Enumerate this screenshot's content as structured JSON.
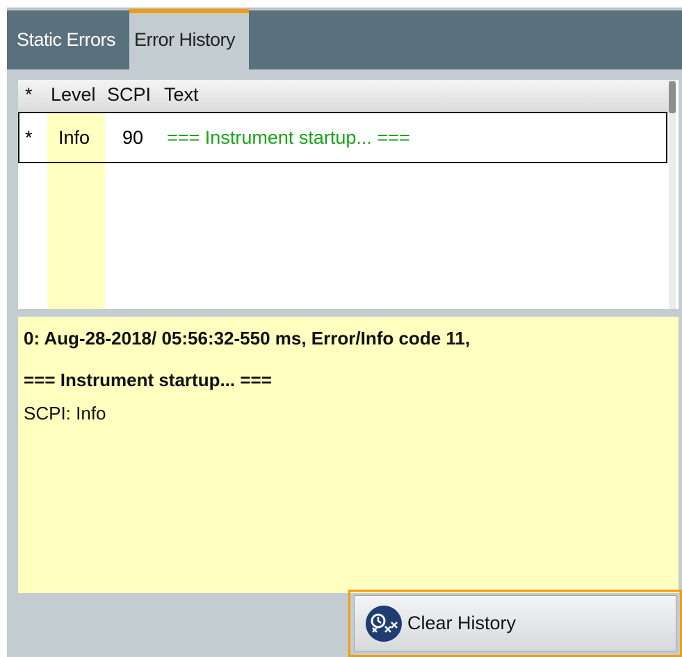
{
  "tabs": [
    {
      "label": "Static Errors"
    },
    {
      "label": "Error History"
    }
  ],
  "table": {
    "columns": [
      "*",
      "Level",
      "SCPI",
      "Text"
    ],
    "rows": [
      {
        "marker": "*",
        "level": "Info",
        "scpi": "90",
        "text": "=== Instrument startup... ==="
      }
    ]
  },
  "details": {
    "line1": "0: Aug-28-2018/ 05:56:32-550 ms, Error/Info code 11,",
    "line2": "=== Instrument startup... ===",
    "line3": "SCPI: Info"
  },
  "buttons": {
    "clear_history": "Clear History",
    "clear_history_icon": "clear-history-icon"
  },
  "colors": {
    "accent": "#f39c12",
    "tabbar": "#5b707d",
    "highlight": "#ffffc0",
    "info_text": "#1aa31a"
  }
}
